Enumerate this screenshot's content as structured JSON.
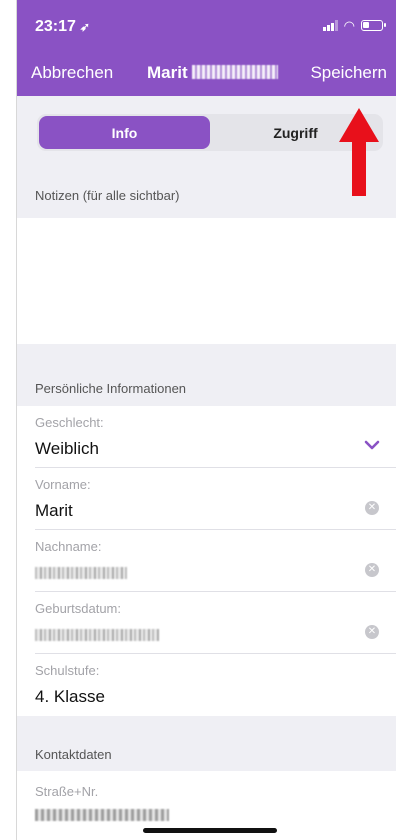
{
  "status_bar": {
    "time": "23:17",
    "location_icon": "location-arrow-icon",
    "signal_icon": "cellular-signal-icon",
    "wifi_icon": "wifi-icon",
    "battery_icon": "battery-low-icon"
  },
  "nav": {
    "cancel_label": "Abbrechen",
    "title": "Marit",
    "save_label": "Speichern"
  },
  "segments": {
    "info_label": "Info",
    "access_label": "Zugriff",
    "selected": "Info"
  },
  "notes": {
    "section_label": "Notizen (für alle sichtbar)",
    "value": ""
  },
  "personal": {
    "section_label": "Persönliche Informationen",
    "gender_label": "Geschlecht:",
    "gender_value": "Weiblich",
    "firstname_label": "Vorname:",
    "firstname_value": "Marit",
    "lastname_label": "Nachname:",
    "birthdate_label": "Geburtsdatum:",
    "grade_label": "Schulstufe:",
    "grade_value": "4. Klasse"
  },
  "contact": {
    "section_label": "Kontaktdaten",
    "street_label": "Straße+Nr."
  },
  "colors": {
    "accent": "#8a52c4",
    "annotation_arrow": "#e8101b",
    "background": "#efeff4"
  }
}
